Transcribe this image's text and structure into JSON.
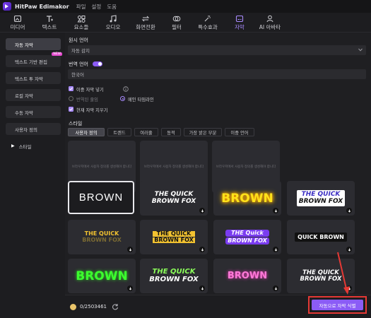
{
  "app": {
    "title": "HitPaw Edimakor",
    "menu": [
      "파일",
      "설정",
      "도움"
    ]
  },
  "toolbar": {
    "tabs": [
      {
        "label": "미디어",
        "icon": "media-icon"
      },
      {
        "label": "텍스트",
        "icon": "text-icon"
      },
      {
        "label": "요소들",
        "icon": "elements-icon"
      },
      {
        "label": "오디오",
        "icon": "audio-icon"
      },
      {
        "label": "화면전환",
        "icon": "transition-icon"
      },
      {
        "label": "필터",
        "icon": "filter-icon"
      },
      {
        "label": "특수효과",
        "icon": "effects-icon"
      },
      {
        "label": "자막",
        "icon": "subtitle-icon",
        "active": true
      },
      {
        "label": "AI 아바타",
        "icon": "ai-avatar-icon"
      }
    ]
  },
  "sidebar": {
    "items": [
      {
        "label": "자동 자막",
        "active": true
      },
      {
        "label": "텍스트 기반 편집",
        "badge": "NEW"
      },
      {
        "label": "텍스트 투 자막"
      },
      {
        "label": "로컬 자막"
      },
      {
        "label": "수동 자막"
      },
      {
        "label": "사용자 정의"
      },
      {
        "label": "스타일"
      }
    ]
  },
  "main": {
    "source_lang_label": "원시 언어",
    "source_lang_value": "자동 감지",
    "translate_label": "번역 언어",
    "translate_value": "한국어",
    "dual_label": "이중 자막 넣기",
    "radio_left": "번역된 줄임",
    "radio_right": "메인 타임라인",
    "clear_label": "현재 자막 지우기",
    "style_label": "스타일",
    "style_tabs": [
      "사용자 정의",
      "트렌드",
      "여러줄",
      "동적",
      "가장 밝은 부분",
      "이중 언어"
    ],
    "placeholder_text": "브라우저에서 사용자 정의를 생성해야 합니다"
  },
  "presets": [
    {
      "text": "BROWN"
    },
    {
      "text1": "THE QUICK",
      "text2": "BROWN FOX"
    },
    {
      "text": "BROWN"
    },
    {
      "text1": "THE QUICK",
      "text2": "BROWN FOX"
    },
    {
      "text1": "THE QUICK",
      "text2": "BROWN FOX"
    },
    {
      "text1": "THE QUICK",
      "text2": "BROWN FOX"
    },
    {
      "text1": "THE Quick",
      "text2": "BROWN FOX"
    },
    {
      "text": "QUICK BROWN"
    },
    {
      "text": "BROWN"
    },
    {
      "text1": "THE QUICK",
      "text2": "BROWN FOX"
    },
    {
      "text": "BROWN"
    },
    {
      "text1": "THE QUICK",
      "text2": "BROWN FOX"
    }
  ],
  "footer": {
    "credits": "0/2503461",
    "action_label": "자동으로 자막 식별"
  }
}
